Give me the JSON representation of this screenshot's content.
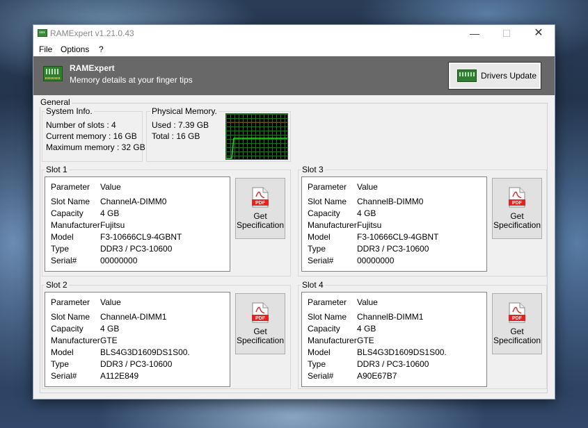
{
  "window": {
    "title": "RAMExpert v1.21.0.43",
    "controls": {
      "minimize": "—",
      "maximize": "☐",
      "close": "✕"
    }
  },
  "menu": [
    "File",
    "Options",
    "?"
  ],
  "banner": {
    "title": "RAMExpert",
    "subtitle": "Memory details at your finger tips",
    "drivers_button": "Drivers Update"
  },
  "general": {
    "legend": "General",
    "system_info": {
      "legend": "System Info.",
      "lines": [
        "Number of slots : 4",
        "Current memory : 16 GB",
        "Maximum memory : 32 GB"
      ]
    },
    "physical_memory": {
      "legend": "Physical Memory.",
      "lines": [
        "Used : 7.39 GB",
        "Total : 16 GB"
      ],
      "used_fraction": 0.46
    }
  },
  "columns": {
    "param": "Parameter",
    "value": "Value"
  },
  "spec_button": {
    "line1": "Get",
    "line2": "Specification",
    "icon_text": "PDF"
  },
  "slots": [
    {
      "legend": "Slot 1",
      "rows": [
        [
          "Slot Name",
          "ChannelA-DIMM0"
        ],
        [
          "Capacity",
          "4 GB"
        ],
        [
          "Manufacturer",
          "Fujitsu"
        ],
        [
          "Model",
          "F3-10666CL9-4GBNT"
        ],
        [
          "Type",
          "DDR3 / PC3-10600"
        ],
        [
          "Serial#",
          "00000000"
        ]
      ]
    },
    {
      "legend": "Slot 3",
      "rows": [
        [
          "Slot Name",
          "ChannelB-DIMM0"
        ],
        [
          "Capacity",
          "4 GB"
        ],
        [
          "Manufacturer",
          "Fujitsu"
        ],
        [
          "Model",
          "F3-10666CL9-4GBNT"
        ],
        [
          "Type",
          "DDR3 / PC3-10600"
        ],
        [
          "Serial#",
          "00000000"
        ]
      ]
    },
    {
      "legend": "Slot 2",
      "rows": [
        [
          "Slot Name",
          "ChannelA-DIMM1"
        ],
        [
          "Capacity",
          "4 GB"
        ],
        [
          "Manufacturer",
          "GTE"
        ],
        [
          "Model",
          "BLS4G3D1609DS1S00."
        ],
        [
          "Type",
          "DDR3 / PC3-10600"
        ],
        [
          "Serial#",
          "A112E849"
        ]
      ]
    },
    {
      "legend": "Slot 4",
      "rows": [
        [
          "Slot Name",
          "ChannelB-DIMM1"
        ],
        [
          "Capacity",
          "4 GB"
        ],
        [
          "Manufacturer",
          "GTE"
        ],
        [
          "Model",
          "BLS4G3D1609DS1S00."
        ],
        [
          "Type",
          "DDR3 / PC3-10600"
        ],
        [
          "Serial#",
          "A90E67B7"
        ]
      ]
    }
  ],
  "colors": {
    "banner_bg": "#686868",
    "graph_grid": "#167816",
    "graph_line": "#35d335",
    "graph_cap": "#d02020",
    "pdf_red": "#e02424"
  }
}
